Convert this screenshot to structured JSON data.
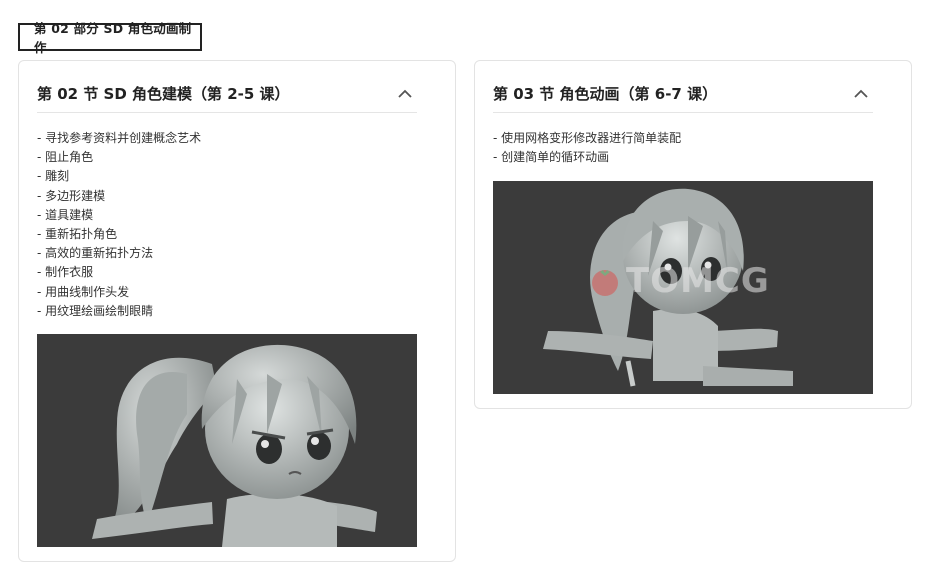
{
  "part_label": "第 02 部分 SD 角色动画制作",
  "sections": [
    {
      "title": "第 02 节 SD 角色建模（第 2-5 课）",
      "items": [
        "- 寻找参考资料并创建概念艺术",
        "- 阻止角色",
        "- 雕刻",
        "- 多边形建模",
        "- 道具建模",
        "- 重新拓扑角色",
        "- 高效的重新拓扑方法",
        "- 制作衣服",
        "- 用曲线制作头发",
        "- 用纹理绘画绘制眼睛"
      ],
      "toggle_icon": "chevron-up-icon"
    },
    {
      "title": "第 03 节 角色动画（第 6-7 课）",
      "items": [
        "- 使用网格变形修改器进行简单装配",
        "- 创建简单的循环动画"
      ],
      "toggle_icon": "chevron-up-icon",
      "watermark": "TOMCG"
    }
  ],
  "colors": {
    "border": "#222222",
    "card_border": "#e3e3e3",
    "image_bg": "#3b3b3b",
    "model_gray": "#b9bebd"
  }
}
